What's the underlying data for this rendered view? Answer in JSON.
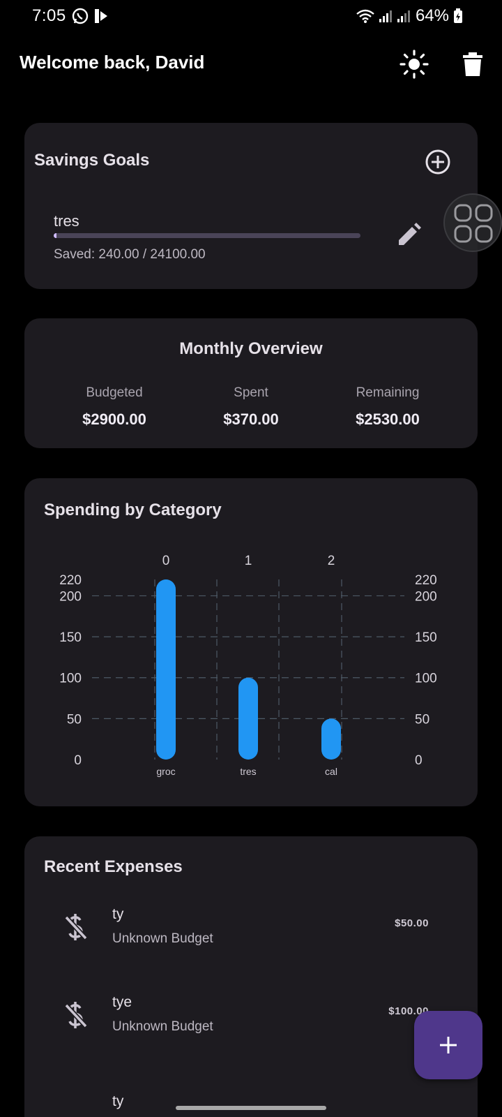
{
  "status_bar": {
    "time": "7:05",
    "battery": "64%"
  },
  "app_bar": {
    "title": "Welcome back, David",
    "icons": [
      "light-mode-icon",
      "delete-icon"
    ]
  },
  "savings_goals": {
    "title": "Savings Goals",
    "goals": [
      {
        "name": "tres",
        "saved_text": "Saved: 240.00 / 24100.00",
        "progress": 0.01
      }
    ]
  },
  "monthly_overview": {
    "title": "Monthly Overview",
    "budgeted": {
      "label": "Budgeted",
      "value": "$2900.00"
    },
    "spent": {
      "label": "Spent",
      "value": "$370.00"
    },
    "remaining": {
      "label": "Remaining",
      "value": "$2530.00"
    }
  },
  "spending_by_category": {
    "title": "Spending by Category",
    "chart_data": {
      "type": "bar",
      "categories": [
        "groc",
        "tres",
        "cal"
      ],
      "top_labels": [
        "0",
        "1",
        "2"
      ],
      "values": [
        220,
        100,
        50
      ],
      "ylim": [
        0,
        220
      ],
      "yticks": [
        "0",
        "50",
        "100",
        "150",
        "200",
        "220"
      ],
      "bar_color": "#2196f3",
      "grid": true
    }
  },
  "recent_expenses": {
    "title": "Recent Expenses",
    "items": [
      {
        "name": "ty",
        "budget": "Unknown Budget",
        "amount": "$50.00"
      },
      {
        "name": "tye",
        "budget": "Unknown Budget",
        "amount": "$100.00"
      },
      {
        "name": "ty",
        "budget": "",
        "amount": ""
      }
    ]
  },
  "fab": {
    "icon": "add-icon"
  },
  "colors": {
    "background": "#000000",
    "card": "#1d1b20",
    "accent": "#4f378b",
    "bar": "#2196f3"
  }
}
